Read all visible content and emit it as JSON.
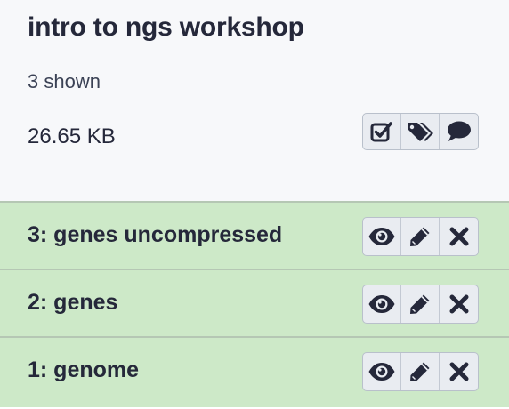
{
  "history": {
    "name": "intro to ngs workshop",
    "shown_text": "3 shown",
    "size": "26.65 KB",
    "actions": [
      {
        "icon": "check-square-icon"
      },
      {
        "icon": "tags-icon"
      },
      {
        "icon": "comment-icon"
      }
    ]
  },
  "datasets": [
    {
      "label": "3: genes uncompressed",
      "state_color": "#cde9c8"
    },
    {
      "label": "2: genes",
      "state_color": "#cde9c8"
    },
    {
      "label": "1: genome",
      "state_color": "#cde9c8"
    }
  ],
  "dataset_actions": [
    {
      "icon": "eye-icon"
    },
    {
      "icon": "pencil-icon"
    },
    {
      "icon": "close-icon"
    }
  ]
}
